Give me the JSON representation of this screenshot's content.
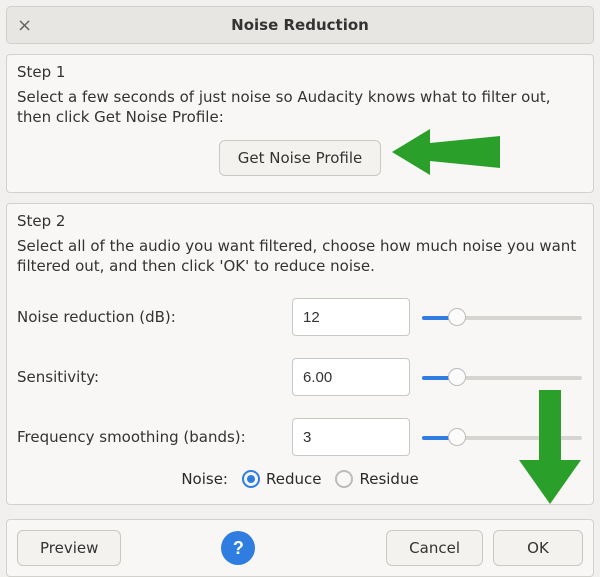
{
  "window": {
    "title": "Noise Reduction",
    "close_glyph": "×"
  },
  "step1": {
    "heading": "Step 1",
    "instruction": "Select a few seconds of just noise so Audacity knows what to filter out, then click Get Noise Profile:",
    "button": "Get Noise Profile"
  },
  "step2": {
    "heading": "Step 2",
    "instruction": "Select all of the audio you want filtered, choose how much noise you want filtered out, and then click 'OK' to reduce noise.",
    "params": {
      "noise_reduction": {
        "label": "Noise reduction (dB):",
        "value": "12",
        "slider_pct": 22
      },
      "sensitivity": {
        "label": "Sensitivity:",
        "value": "6.00",
        "slider_pct": 22
      },
      "freq_smoothing": {
        "label": "Frequency smoothing (bands):",
        "value": "3",
        "slider_pct": 22
      }
    },
    "noise_label": "Noise:",
    "radio_reduce": "Reduce",
    "radio_residue": "Residue",
    "radio_selected": "reduce"
  },
  "actions": {
    "preview": "Preview",
    "help_glyph": "?",
    "cancel": "Cancel",
    "ok": "OK"
  },
  "colors": {
    "accent": "#2f7de1",
    "arrow": "#2aa02a"
  }
}
